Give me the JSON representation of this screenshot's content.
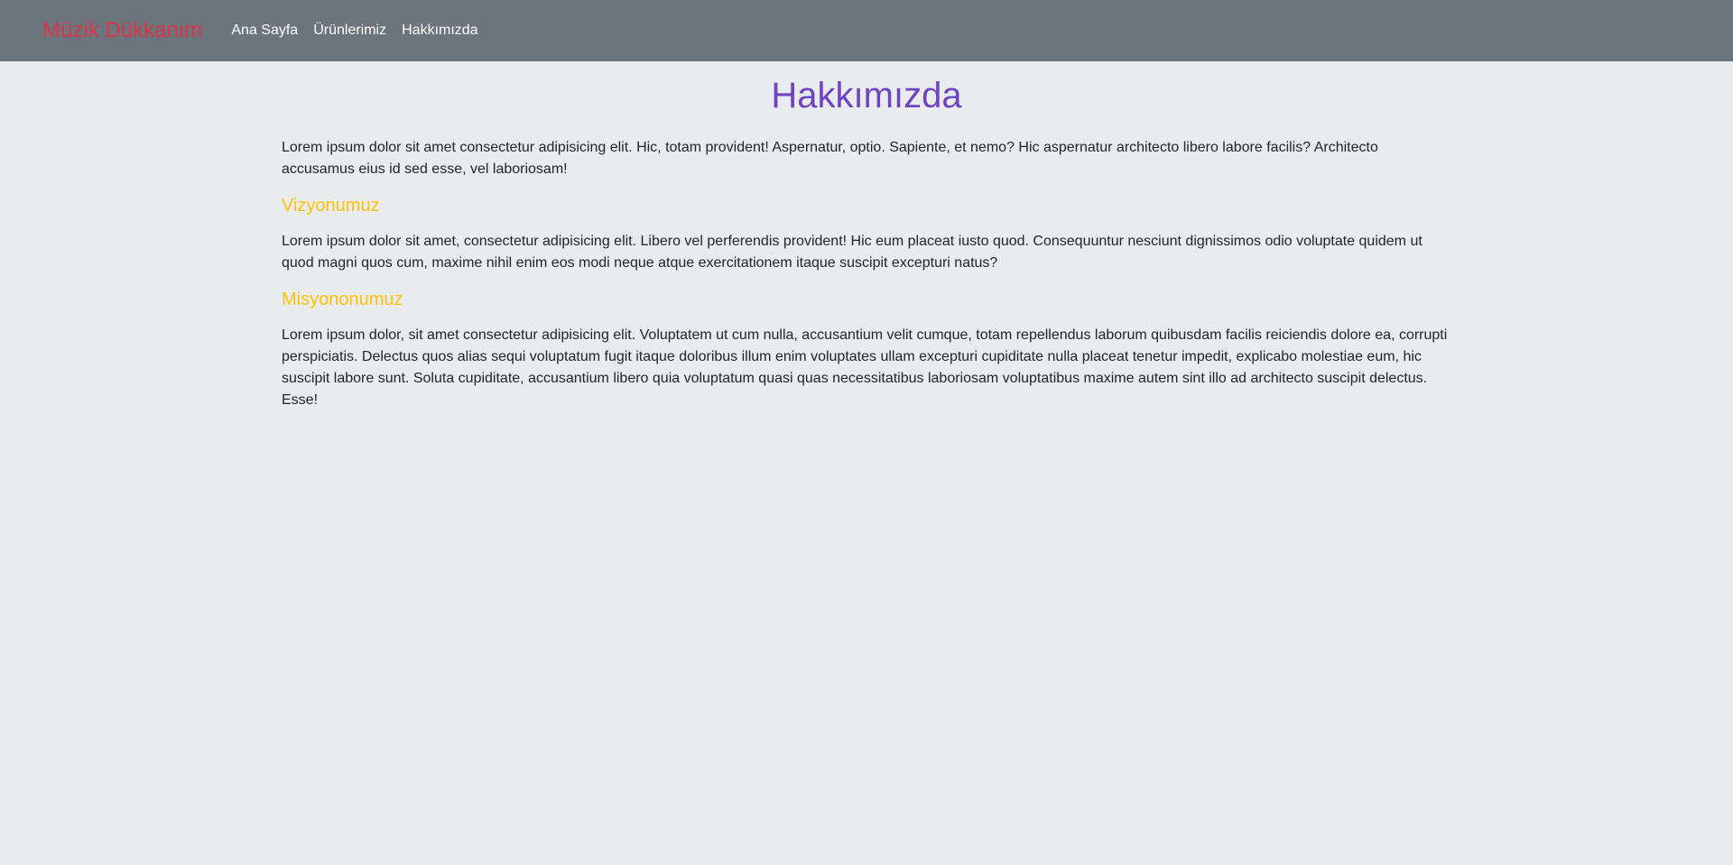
{
  "navbar": {
    "brand": "Müzik Dükkanım",
    "links": [
      {
        "label": "Ana Sayfa"
      },
      {
        "label": "Ürünlerimiz"
      },
      {
        "label": "Hakkımızda"
      }
    ]
  },
  "main": {
    "title": "Hakkımızda",
    "intro": "Lorem ipsum dolor sit amet consectetur adipisicing elit. Hic, totam provident! Aspernatur, optio. Sapiente, et nemo? Hic aspernatur architecto libero labore facilis? Architecto accusamus eius id sed esse, vel laboriosam!",
    "vision": {
      "heading": "Vizyonumuz",
      "text": "Lorem ipsum dolor sit amet, consectetur adipisicing elit. Libero vel perferendis provident! Hic eum placeat iusto quod. Consequuntur nesciunt dignissimos odio voluptate quidem ut quod magni quos cum, maxime nihil enim eos modi neque atque exercitationem itaque suscipit excepturi natus?"
    },
    "mission": {
      "heading": "Misyononumuz",
      "text": "Lorem ipsum dolor, sit amet consectetur adipisicing elit. Voluptatem ut cum nulla, accusantium velit cumque, totam repellendus laborum quibusdam facilis reiciendis dolore ea, corrupti perspiciatis. Delectus quos alias sequi voluptatum fugit itaque doloribus illum enim voluptates ullam excepturi cupiditate nulla placeat tenetur impedit, explicabo molestiae eum, hic suscipit labore sunt. Soluta cupiditate, accusantium libero quia voluptatum quasi quas necessitatibus laboriosam voluptatibus maxime autem sint illo ad architecto suscipit delectus. Esse!"
    }
  },
  "colors": {
    "navbar_bg": "#6c757d",
    "brand": "#dc3545",
    "title": "#6f42c1",
    "section_heading": "#ffc107",
    "page_bg": "#e9ecef"
  }
}
